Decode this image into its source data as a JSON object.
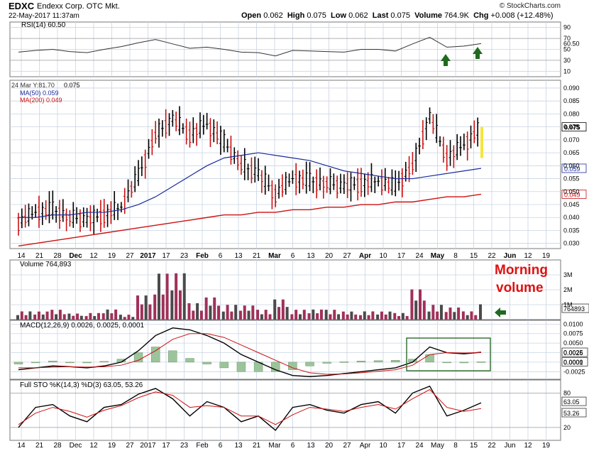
{
  "header": {
    "symbol": "EDXC",
    "company": "Endexx Corp. OTC Mkt.",
    "datetime": "22-May-2017 11:37am",
    "brand": "© StockCharts.com",
    "open_label": "Open",
    "open": "0.062",
    "high_label": "High",
    "high": "0.075",
    "low_label": "Low",
    "low": "0.062",
    "last_label": "Last",
    "last": "0.075",
    "volume_label": "Volume",
    "volume": "764.9K",
    "chg_label": "Chg",
    "chg": "+0.008 (+12.48%)"
  },
  "panels": {
    "rsi": {
      "label": "RSI(14) 60.50",
      "value": "60.50",
      "ticks": [
        "90",
        "70",
        "50",
        "30",
        "10"
      ]
    },
    "price": {
      "date_label": "24 Mar Y:81.70",
      "close_label": "0.075",
      "ma50_label": "MA(50) 0.059",
      "ma200_label": "MA(200) 0.049",
      "ticks": [
        "0.090",
        "0.085",
        "0.080",
        "0.075",
        "0.070",
        "0.065",
        "0.060",
        "0.055",
        "0.050",
        "0.045",
        "0.040",
        "0.035",
        "0.030"
      ],
      "last_badge": "0.075",
      "ma50_badge": "0.059",
      "ma200_badge": "0.049"
    },
    "volume": {
      "label": "Volume 764,893",
      "ticks": [
        "3M",
        "2M",
        "1M"
      ],
      "badge": "764893",
      "annotation_line1": "Morning",
      "annotation_line2": "volume"
    },
    "macd": {
      "label": "MACD(12,26,9) 0.0026, 0.0025, 0.0001",
      "ticks": [
        "0.0100",
        "0.0075",
        "0.0050",
        "0.0025",
        "0.0000",
        "-0.0025"
      ],
      "badge1": "0.0026",
      "badge2": "0.0001"
    },
    "sto": {
      "label": "Full STO %K(14,3) %D(3) 63.05, 53.26",
      "ticks": [
        "80",
        "20"
      ],
      "badge1": "63.05",
      "badge2": "53.26"
    }
  },
  "x_axis_labels": [
    "14",
    "21",
    "28",
    "Dec",
    "12",
    "19",
    "27",
    "2017",
    "17",
    "23",
    "Feb",
    "6",
    "13",
    "21",
    "Mar",
    "6",
    "13",
    "20",
    "27",
    "Apr",
    "10",
    "17",
    "24",
    "May",
    "8",
    "15",
    "22",
    "Jun",
    "12",
    "19"
  ],
  "colors": {
    "up": "#000000",
    "down": "#cc1111",
    "ma50": "#1a2a9a",
    "ma200": "#cc1111",
    "grid": "#c8d4e4",
    "annotation": "#e01010",
    "arrow": "#1f6a1f",
    "highlight": "#f5e63a",
    "macd_hist": "#9cc49a",
    "vol_down": "#a0305a",
    "vol_up": "#4a4a4a"
  },
  "chart_data": {
    "type": "ohlc",
    "x": [
      "2016-11-14",
      "2016-11-21",
      "2016-11-28",
      "2016-12-05",
      "2016-12-12",
      "2016-12-19",
      "2016-12-27",
      "2017-01-03",
      "2017-01-09",
      "2017-01-17",
      "2017-01-23",
      "2017-01-30",
      "2017-02-06",
      "2017-02-13",
      "2017-02-21",
      "2017-02-27",
      "2017-03-06",
      "2017-03-13",
      "2017-03-20",
      "2017-03-27",
      "2017-04-03",
      "2017-04-10",
      "2017-04-17",
      "2017-04-24",
      "2017-05-01",
      "2017-05-08",
      "2017-05-15",
      "2017-05-22"
    ],
    "close": [
      0.038,
      0.042,
      0.043,
      0.04,
      0.039,
      0.041,
      0.044,
      0.056,
      0.072,
      0.078,
      0.072,
      0.076,
      0.069,
      0.06,
      0.057,
      0.049,
      0.055,
      0.054,
      0.053,
      0.052,
      0.053,
      0.054,
      0.052,
      0.06,
      0.079,
      0.063,
      0.068,
      0.075
    ],
    "ma50": [
      0.04,
      0.04,
      0.041,
      0.041,
      0.042,
      0.042,
      0.043,
      0.045,
      0.048,
      0.052,
      0.056,
      0.06,
      0.063,
      0.064,
      0.065,
      0.064,
      0.063,
      0.062,
      0.06,
      0.058,
      0.057,
      0.056,
      0.055,
      0.055,
      0.056,
      0.057,
      0.058,
      0.059
    ],
    "ma200": [
      0.029,
      0.03,
      0.031,
      0.032,
      0.033,
      0.034,
      0.035,
      0.036,
      0.037,
      0.038,
      0.039,
      0.04,
      0.041,
      0.041,
      0.042,
      0.042,
      0.043,
      0.043,
      0.044,
      0.044,
      0.045,
      0.045,
      0.046,
      0.046,
      0.047,
      0.048,
      0.048,
      0.049
    ],
    "volume": [
      0.5,
      0.4,
      0.6,
      0.3,
      0.4,
      0.5,
      0.3,
      1.2,
      2.8,
      2.3,
      1.0,
      1.1,
      0.9,
      0.7,
      0.6,
      1.0,
      0.6,
      0.5,
      0.6,
      0.4,
      0.5,
      0.4,
      0.4,
      1.5,
      0.9,
      0.6,
      0.5,
      0.76
    ],
    "rsi": [
      45,
      48,
      50,
      46,
      44,
      50,
      55,
      62,
      68,
      60,
      52,
      54,
      50,
      45,
      44,
      38,
      48,
      47,
      46,
      45,
      50,
      50,
      47,
      60,
      72,
      54,
      56,
      60.5
    ],
    "macd": [
      -0.002,
      -0.0015,
      -0.001,
      -0.0012,
      -0.0015,
      -0.001,
      0.0,
      0.003,
      0.007,
      0.009,
      0.0085,
      0.007,
      0.005,
      0.002,
      0.0,
      -0.002,
      -0.0035,
      -0.0038,
      -0.0035,
      -0.003,
      -0.0025,
      -0.002,
      -0.0015,
      0.0,
      0.004,
      0.0025,
      0.0022,
      0.0026
    ],
    "macd_signal": [
      -0.0015,
      -0.0015,
      -0.0013,
      -0.0012,
      -0.0013,
      -0.0012,
      -0.0008,
      0.0005,
      0.003,
      0.006,
      0.0075,
      0.0075,
      0.0065,
      0.0045,
      0.0025,
      0.0005,
      -0.0015,
      -0.0028,
      -0.0032,
      -0.0031,
      -0.0028,
      -0.0024,
      -0.002,
      -0.0008,
      0.002,
      0.0025,
      0.0024,
      0.0025
    ],
    "sto_k": [
      20,
      55,
      60,
      40,
      30,
      55,
      60,
      78,
      88,
      70,
      40,
      65,
      55,
      30,
      40,
      15,
      55,
      60,
      50,
      45,
      60,
      65,
      45,
      80,
      92,
      40,
      50,
      63
    ],
    "sto_d": [
      25,
      45,
      55,
      48,
      38,
      50,
      58,
      72,
      82,
      76,
      55,
      58,
      55,
      40,
      40,
      25,
      42,
      55,
      52,
      48,
      55,
      60,
      52,
      70,
      86,
      55,
      48,
      53
    ]
  }
}
